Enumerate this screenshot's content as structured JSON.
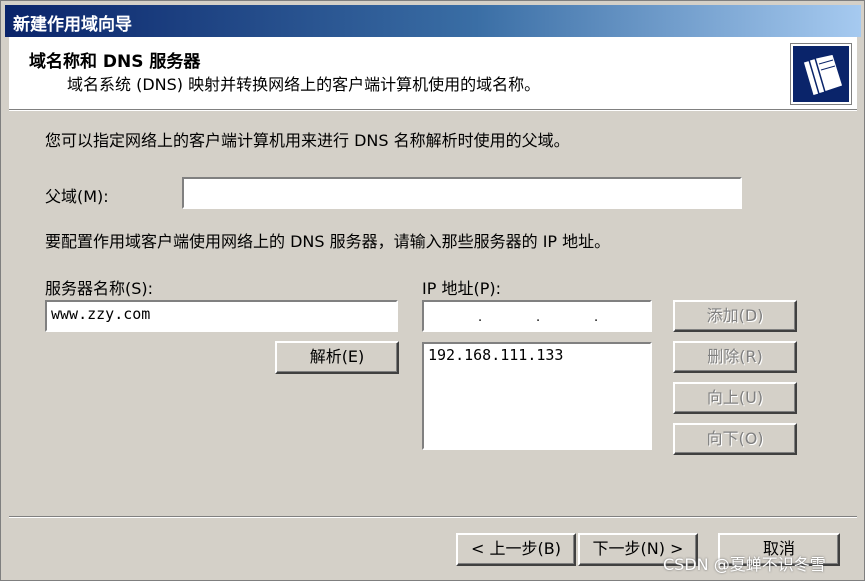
{
  "window": {
    "title": "新建作用域向导"
  },
  "header": {
    "title": "域名称和 DNS 服务器",
    "subtitle": "域名系统 (DNS) 映射并转换网络上的客户端计算机使用的域名称。",
    "icon": "folders-icon"
  },
  "body": {
    "parent_intro": "您可以指定网络上的客户端计算机用来进行 DNS 名称解析时使用的父域。",
    "parent_label": "父域(M):",
    "parent_value": "",
    "dns_intro": "要配置作用域客户端使用网络上的 DNS 服务器，请输入那些服务器的 IP 地址。",
    "server_label": "服务器名称(S):",
    "server_value": "www.zzy.com",
    "resolve_button": "解析(E)",
    "ip_label": "IP 地址(P):",
    "ip_input_value": "",
    "ip_list": [
      "192.168.111.133"
    ],
    "add_button": "添加(D)",
    "remove_button": "删除(R)",
    "up_button": "向上(U)",
    "down_button": "向下(O)"
  },
  "footer": {
    "back_button": "< 上一步(B)",
    "next_button": "下一步(N) >",
    "cancel_button": "取消"
  },
  "watermark": "CSDN @夏蝉不识冬雪",
  "colors": {
    "face": "#d4d0c8",
    "titlebar_start": "#0a246a",
    "titlebar_end": "#a6caf0"
  }
}
